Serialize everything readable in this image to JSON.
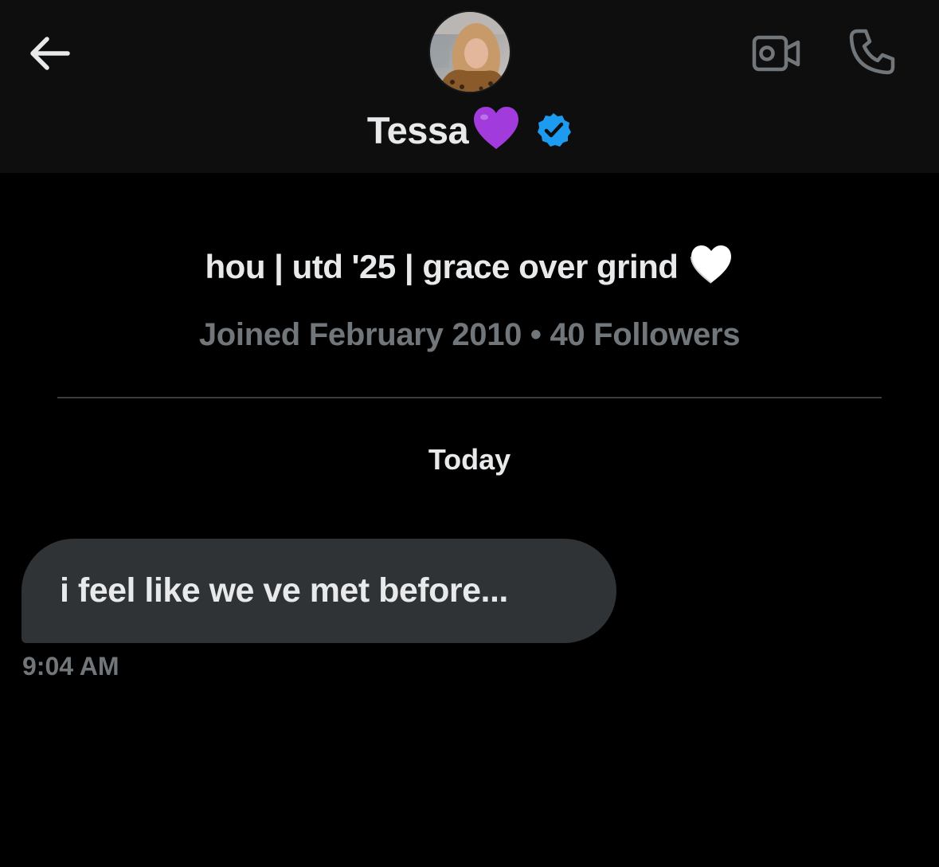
{
  "header": {
    "back_icon": "arrow-left-icon",
    "video_icon": "video-camera-icon",
    "call_icon": "phone-icon",
    "avatar_icon": "profile-avatar",
    "name": "Tessa",
    "name_emoji": "purple-heart-icon",
    "verified_icon": "verified-badge-icon"
  },
  "profile": {
    "bio": "hou | utd '25 | grace over grind",
    "bio_emoji": "white-heart-icon",
    "meta": "Joined February 2010 • 40 Followers"
  },
  "conversation": {
    "date_separator": "Today",
    "messages": [
      {
        "text": "i feel like we ve met before...",
        "time": "9:04 AM",
        "direction": "incoming"
      }
    ]
  },
  "colors": {
    "background": "#000000",
    "header_background": "#0e0e0e",
    "primary_text": "#e7e9ea",
    "secondary_text": "#71767b",
    "bubble": "#2f3336",
    "verified": "#1d9bf0",
    "purple_heart": "#a23bdb"
  }
}
